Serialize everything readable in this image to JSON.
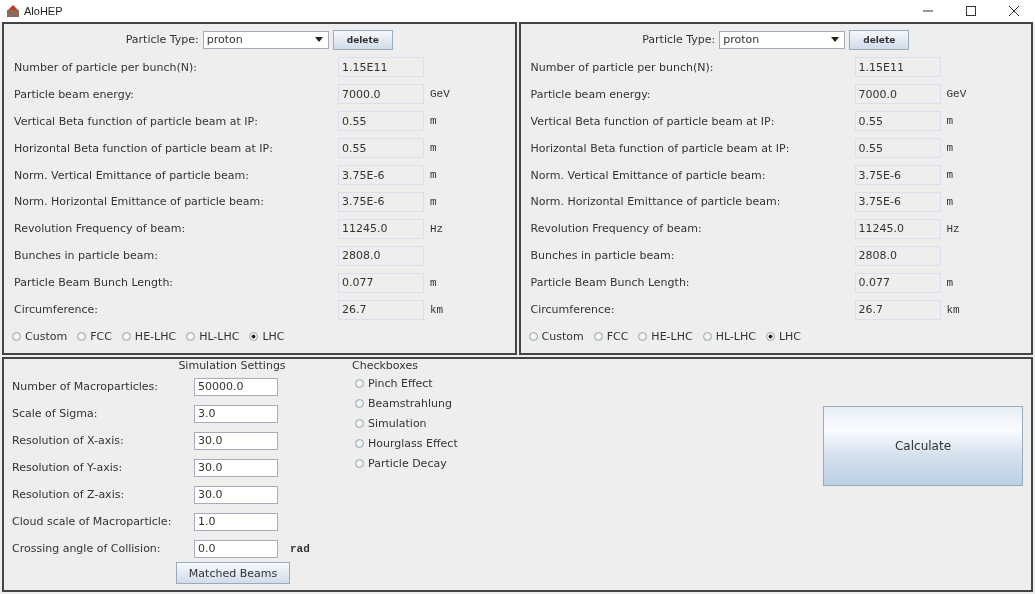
{
  "window": {
    "title": "AloHEP"
  },
  "beams": [
    {
      "particle_type": {
        "label": "Particle Type:",
        "value": "proton"
      },
      "delete_button": "delete",
      "parameters": [
        {
          "label": "Number of particle per bunch(N):",
          "value": "1.15E11"
        },
        {
          "label": "Particle beam energy:",
          "value": "7000.0",
          "unit": "GeV"
        },
        {
          "label": "Vertical Beta function of particle beam at IP:",
          "value": "0.55",
          "unit": "m"
        },
        {
          "label": "Horizontal Beta function of particle beam at IP:",
          "value": "0.55",
          "unit": "m"
        },
        {
          "label": "Norm. Vertical Emittance of particle beam:",
          "value": "3.75E-6",
          "unit": "m"
        },
        {
          "label": "Norm. Horizontal Emittance of particle beam:",
          "value": "3.75E-6",
          "unit": "m"
        },
        {
          "label": "Revolution Frequency of beam:",
          "value": "11245.0",
          "unit": "Hz"
        },
        {
          "label": "Bunches in particle beam:",
          "value": "2808.0"
        },
        {
          "label": "Particle Beam Bunch Length:",
          "value": "0.077",
          "unit": "m"
        },
        {
          "label": "Circumference:",
          "value": "26.7",
          "unit": "km"
        }
      ],
      "presets": [
        {
          "label": "Custom",
          "selected": false
        },
        {
          "label": "FCC",
          "selected": false
        },
        {
          "label": "HE-LHC",
          "selected": false
        },
        {
          "label": "HL-LHC",
          "selected": false
        },
        {
          "label": "LHC",
          "selected": true
        }
      ]
    },
    {
      "particle_type": {
        "label": "Particle Type:",
        "value": "proton"
      },
      "delete_button": "delete",
      "parameters": [
        {
          "label": "Number of particle per bunch(N):",
          "value": "1.15E11"
        },
        {
          "label": "Particle beam energy:",
          "value": "7000.0",
          "unit": "GeV"
        },
        {
          "label": "Vertical Beta function of particle beam at IP:",
          "value": "0.55",
          "unit": "m"
        },
        {
          "label": "Horizontal Beta function of particle beam at IP:",
          "value": "0.55",
          "unit": "m"
        },
        {
          "label": "Norm. Vertical Emittance of particle beam:",
          "value": "3.75E-6",
          "unit": "m"
        },
        {
          "label": "Norm. Horizontal Emittance of particle beam:",
          "value": "3.75E-6",
          "unit": "m"
        },
        {
          "label": "Revolution Frequency of beam:",
          "value": "11245.0",
          "unit": "Hz"
        },
        {
          "label": "Bunches in particle beam:",
          "value": "2808.0"
        },
        {
          "label": "Particle Beam Bunch Length:",
          "value": "0.077",
          "unit": "m"
        },
        {
          "label": "Circumference:",
          "value": "26.7",
          "unit": "km"
        }
      ],
      "presets": [
        {
          "label": "Custom",
          "selected": false
        },
        {
          "label": "FCC",
          "selected": false
        },
        {
          "label": "HE-LHC",
          "selected": false
        },
        {
          "label": "HL-LHC",
          "selected": false
        },
        {
          "label": "LHC",
          "selected": true
        }
      ]
    }
  ],
  "simulation_settings": {
    "title": "Simulation Settings",
    "fields": [
      {
        "label": "Number of Macroparticles:",
        "value": "50000.0"
      },
      {
        "label": "Scale of Sigma:",
        "value": "3.0"
      },
      {
        "label": "Resolution of X-axis:",
        "value": "30.0"
      },
      {
        "label": "Resolution of Y-axis:",
        "value": "30.0"
      },
      {
        "label": "Resolution of Z-axis:",
        "value": "30.0"
      },
      {
        "label": "Cloud scale of Macroparticle:",
        "value": "1.0"
      },
      {
        "label": "Crossing angle of Collision:",
        "value": "0.0",
        "unit": "rad"
      }
    ],
    "button": "Matched Beams"
  },
  "checkboxes": {
    "title": "Checkboxes",
    "items": [
      {
        "label": "Pinch Effect",
        "checked": false
      },
      {
        "label": "Beamstrahlung",
        "checked": false
      },
      {
        "label": "Simulation",
        "checked": false
      },
      {
        "label": "Hourglass Effect",
        "checked": false
      },
      {
        "label": "Particle Decay",
        "checked": false
      }
    ]
  },
  "calculate_button": "Calculate"
}
